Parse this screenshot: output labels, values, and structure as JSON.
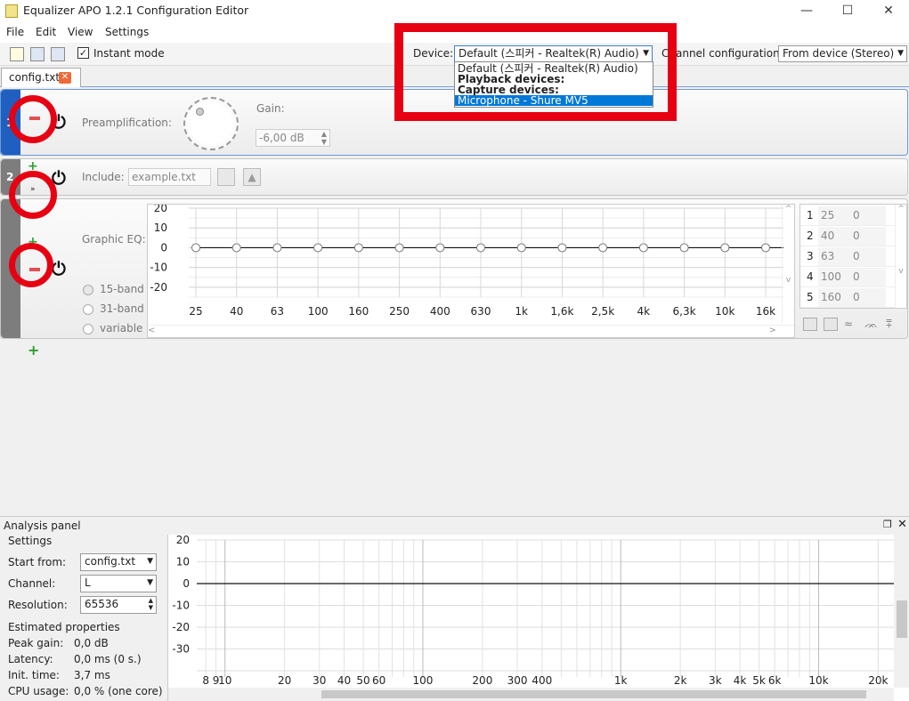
{
  "window": {
    "title": "Equalizer APO 1.2.1 Configuration Editor",
    "min": "—",
    "max": "☐",
    "close": "✕"
  },
  "menu": [
    "File",
    "Edit",
    "View",
    "Settings"
  ],
  "toolbar": {
    "instant_mode": "Instant mode",
    "device_label": "Device:",
    "device_value": "Default (스피커 - Realtek(R) Audio)",
    "channel_label": "Channel configuration:",
    "channel_value": "From device (Stereo)"
  },
  "dropdown": {
    "items": [
      "Default (스피커 - Realtek(R) Audio)",
      "Playback devices:",
      "Capture devices:",
      "Microphone - Shure MV5"
    ]
  },
  "tab": {
    "label": "config.txt"
  },
  "filters": {
    "preamp": {
      "index": "1",
      "label": "Preamplification:",
      "gain_label": "Gain:",
      "gain_value": "-6,00 dB"
    },
    "include": {
      "index": "2",
      "label": "Include:",
      "placeholder": "example.txt"
    },
    "geq": {
      "label": "Graphic EQ:",
      "y_ticks": [
        "20",
        "10",
        "0",
        "-10",
        "-20"
      ],
      "x_ticks": [
        "25",
        "40",
        "63",
        "100",
        "160",
        "250",
        "400",
        "630",
        "1k",
        "1,6k",
        "2,5k",
        "4k",
        "6,3k",
        "10k",
        "16k"
      ],
      "modes": [
        "15-band",
        "31-band",
        "variable"
      ],
      "table": [
        [
          "1",
          "25",
          "0"
        ],
        [
          "2",
          "40",
          "0"
        ],
        [
          "3",
          "63",
          "0"
        ],
        [
          "4",
          "100",
          "0"
        ],
        [
          "5",
          "160",
          "0"
        ]
      ]
    }
  },
  "analysis": {
    "title": "Analysis panel",
    "settings_title": "Settings",
    "start_from_label": "Start from:",
    "start_from_value": "config.txt",
    "channel_label": "Channel:",
    "channel_value": "L",
    "resolution_label": "Resolution:",
    "resolution_value": "65536",
    "estimated_title": "Estimated properties",
    "props": [
      {
        "label": "Peak gain:",
        "value": "0,0 dB"
      },
      {
        "label": "Latency:",
        "value": "0,0 ms (0 s.)"
      },
      {
        "label": "Init. time:",
        "value": "3,7 ms"
      },
      {
        "label": "CPU usage:",
        "value": "0,0 % (one core)"
      }
    ],
    "y_ticks": [
      "20",
      "10",
      "0",
      "-10",
      "-20",
      "-30"
    ],
    "x_ticks": [
      "8",
      "9",
      "10",
      "20",
      "30",
      "40",
      "50",
      "60",
      "100",
      "200",
      "300",
      "400",
      "1k",
      "2k",
      "3k",
      "4k",
      "5k",
      "6k",
      "10k",
      "20k"
    ]
  },
  "chart_data": {
    "type": "line",
    "ylim": [
      -30,
      20
    ],
    "series": [
      {
        "values": [
          0,
          0
        ]
      }
    ],
    "categories": [
      "8",
      "20k"
    ]
  },
  "colors": {
    "accent": "#e60012",
    "selection": "#0078d7"
  }
}
